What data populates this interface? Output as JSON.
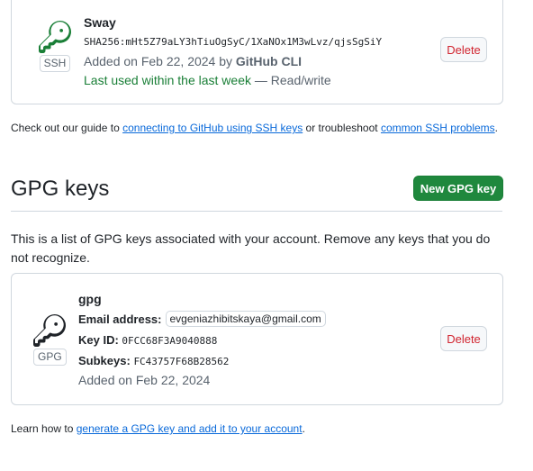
{
  "ssh_key": {
    "name": "Sway",
    "fingerprint": "SHA256:mHt5Z79aLY3hTiuOgSyC/1XaNOx1M3wLvz/qjsSgSiY",
    "added_prefix": "Added on Feb 22, 2024 by",
    "added_by": "GitHub CLI",
    "last_used": "Last used within the last week",
    "access": "— Read/write",
    "badge": "SSH",
    "delete_label": "Delete",
    "icon": "key-icon"
  },
  "ssh_help": {
    "prefix": "Check out our guide to",
    "link1": "connecting to GitHub using SSH keys",
    "middle": "or troubleshoot",
    "link2": "common SSH problems",
    "suffix": "."
  },
  "gpg_section": {
    "heading": "GPG keys",
    "new_button": "New GPG key",
    "description": "This is a list of GPG keys associated with your account. Remove any keys that you do not recognize."
  },
  "gpg_key": {
    "name": "gpg",
    "email_label": "Email address:",
    "email": "evgeniazhibitskaya@gmail.com",
    "key_id_label": "Key ID:",
    "key_id": "0FCC68F3A9040888",
    "subkeys_label": "Subkeys:",
    "subkeys": "FC43757F68B28562",
    "added": "Added on Feb 22, 2024",
    "badge": "GPG",
    "delete_label": "Delete",
    "icon": "key-icon"
  },
  "gpg_help": {
    "prefix": "Learn how to",
    "link": "generate a GPG key and add it to your account",
    "suffix": "."
  },
  "colors": {
    "primary_button": "#1f883d",
    "danger_text": "#d1242f",
    "link": "#0969da",
    "success_text": "#1a7f37"
  }
}
